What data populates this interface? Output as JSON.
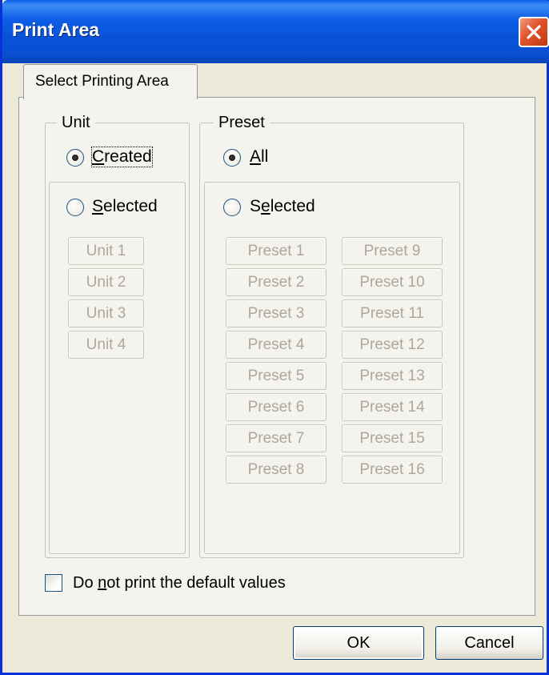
{
  "window": {
    "title": "Print Area"
  },
  "tab": {
    "label": "Select Printing Area"
  },
  "unit": {
    "group_label": "Unit",
    "created_label": "reated",
    "created_underline": "C",
    "selected_label_rest": "elected",
    "selected_underline": "S",
    "buttons": [
      "Unit 1",
      "Unit 2",
      "Unit 3",
      "Unit 4"
    ],
    "selected_option": "Created"
  },
  "preset": {
    "group_label": "Preset",
    "all_underline": "A",
    "all_label_rest": "ll",
    "selected_before": "S",
    "selected_underline": "e",
    "selected_after": "lected",
    "buttons_left": [
      "Preset 1",
      "Preset 2",
      "Preset 3",
      "Preset 4",
      "Preset 5",
      "Preset 6",
      "Preset 7",
      "Preset 8"
    ],
    "buttons_right": [
      "Preset 9",
      "Preset 10",
      "Preset 11",
      "Preset 12",
      "Preset 13",
      "Preset 14",
      "Preset 15",
      "Preset 16"
    ],
    "selected_option": "All"
  },
  "options": {
    "default_values_before": "Do ",
    "default_values_underline": "n",
    "default_values_after": "ot print the default values",
    "default_values_checked": false
  },
  "footer": {
    "ok_label": "OK",
    "cancel_label": "Cancel"
  }
}
